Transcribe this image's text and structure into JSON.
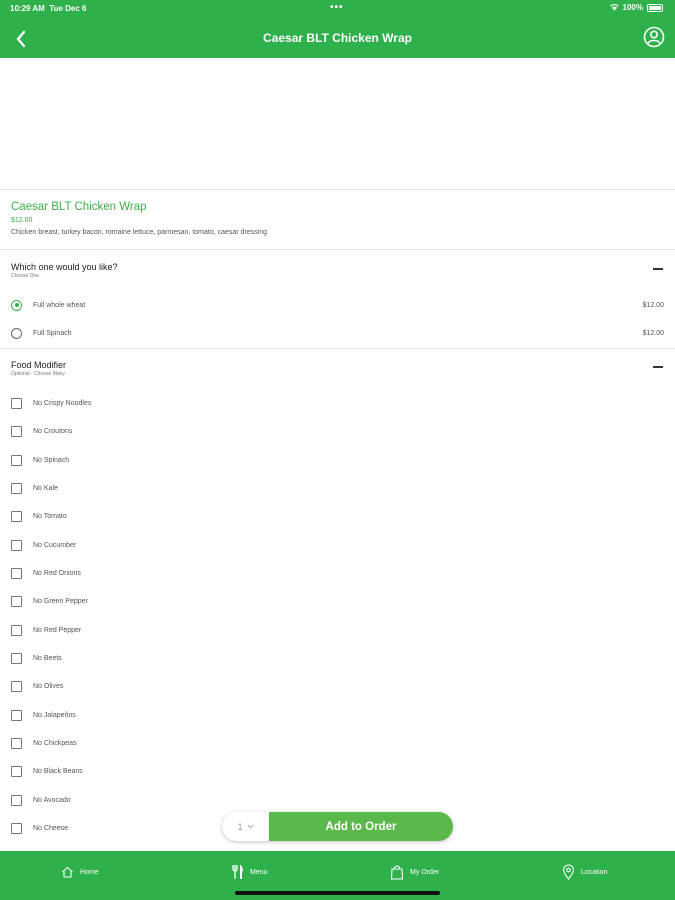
{
  "status_bar": {
    "time": "10:29 AM",
    "date": "Tue Dec 6",
    "battery": "100%"
  },
  "header": {
    "title": "Caesar BLT Chicken Wrap"
  },
  "item": {
    "name": "Caesar BLT Chicken Wrap",
    "price": "$12.00",
    "description": "Chicken breast, turkey bacon, romaine lettuce, parmesan, tomato, caesar dressing"
  },
  "choice_section": {
    "title": "Which one would you like?",
    "subtitle": "Choose One",
    "options": [
      {
        "label": "Full whole wheat",
        "price": "$12.00",
        "selected": true
      },
      {
        "label": "Full Spinach",
        "price": "$12.00",
        "selected": false
      }
    ]
  },
  "modifier_section": {
    "title": "Food Modifier",
    "subtitle": "Optional - Choose Many",
    "options": [
      "No Crispy Noodles",
      "No Croutons",
      "No Spinach",
      "No Kale",
      "No Tomato",
      "No Cucumber",
      "No Red Onions",
      "No Green Pepper",
      "No Red Pepper",
      "No Beets",
      "No Olives",
      "No Jalapeños",
      "No Chickpeas",
      "No Black Beans",
      "No Avocado",
      "No Cheese"
    ]
  },
  "order": {
    "quantity": "1",
    "add_label": "Add to Order"
  },
  "tabs": [
    {
      "label": "Home",
      "icon": "home-icon"
    },
    {
      "label": "Menu",
      "icon": "fork-knife-icon"
    },
    {
      "label": "My Order",
      "icon": "bag-icon"
    },
    {
      "label": "Location",
      "icon": "location-pin-icon"
    }
  ],
  "colors": {
    "brand_green": "#2eb04a",
    "accent_green": "#3cae48",
    "button_green": "#5bb94c"
  }
}
